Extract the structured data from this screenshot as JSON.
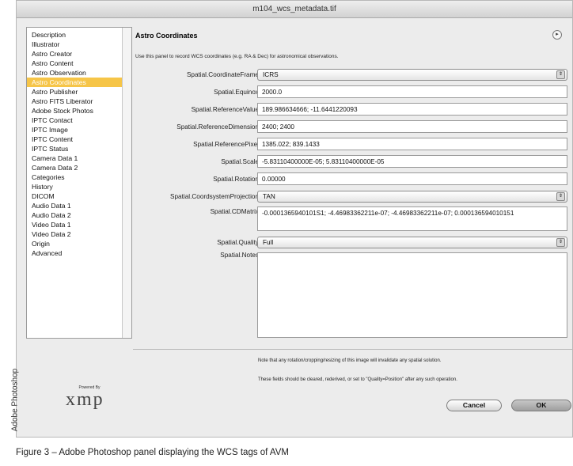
{
  "window": {
    "title": "m104_wcs_metadata.tif"
  },
  "sidebar": {
    "items": [
      "Description",
      "Illustrator",
      "Astro Creator",
      "Astro Content",
      "Astro Observation",
      "Astro Coordinates",
      "Astro Publisher",
      "Astro FITS Liberator",
      "Adobe Stock Photos",
      "IPTC Contact",
      "IPTC Image",
      "IPTC Content",
      "IPTC Status",
      "Camera Data 1",
      "Camera Data 2",
      "Categories",
      "History",
      "DICOM",
      "Audio Data 1",
      "Audio Data 2",
      "Video Data 1",
      "Video Data 2",
      "Origin",
      "Advanced"
    ],
    "selected": "Astro Coordinates"
  },
  "panel": {
    "title": "Astro Coordinates",
    "description": "Use this panel to record WCS coordinates (e.g. RA & Dec) for astronomical observations."
  },
  "fields": {
    "frame": {
      "label": "Spatial.CoordinateFrame",
      "value": "ICRS"
    },
    "equinox": {
      "label": "Spatial.Equinox",
      "value": "2000.0"
    },
    "ref_value": {
      "label": "Spatial.ReferenceValue",
      "value": "189.986634666; -11.6441220093"
    },
    "ref_dimension": {
      "label": "Spatial.ReferenceDimension",
      "value": "2400; 2400"
    },
    "ref_pixel": {
      "label": "Spatial.ReferencePixel",
      "value": "1385.022; 839.1433"
    },
    "scale": {
      "label": "Spatial.Scale",
      "value": "-5.83110400000E-05; 5.83110400000E-05"
    },
    "rotation": {
      "label": "Spatial.Rotation",
      "value": "0.00000"
    },
    "projection": {
      "label": "Spatial.CoordsystemProjection",
      "value": "TAN"
    },
    "cd_matrix": {
      "label": "Spatial.CDMatrix",
      "value": "-0.0001365940101S1; -4.46983362211e-07; -4.46983362211e-07; 0.000136594010151"
    },
    "quality": {
      "label": "Spatial.Quality",
      "value": "Full"
    },
    "notes": {
      "label": "Spatial.Notes",
      "value": ""
    }
  },
  "notes": {
    "line1": "Note that any rotation/cropping/resizing of this image will invalidate any spatial solution.",
    "line2": "These fields should be cleared, rederived, or set to \"Quality=Position\" after any such operation."
  },
  "buttons": {
    "cancel": "Cancel",
    "ok": "OK"
  },
  "logo": {
    "powered_by": "Powered By",
    "wordmark": "xmp"
  },
  "side_caption": "Adobe Photoshop",
  "figure_caption": "Figure 3 – Adobe Photoshop panel displaying the WCS tags of AVM"
}
